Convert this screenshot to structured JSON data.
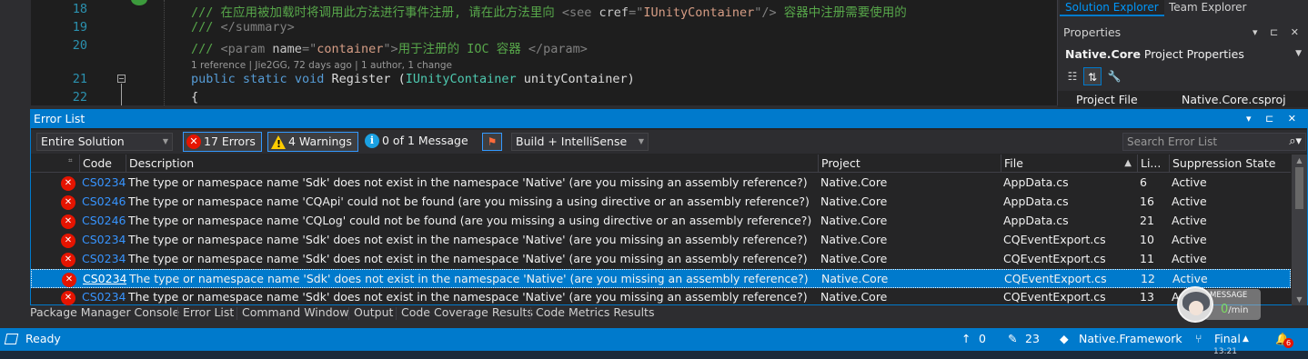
{
  "editor": {
    "lines": [
      {
        "num": "18",
        "segments": [
          {
            "cls": "c-com",
            "t": "/// 在应用被加载时将调用此方法进行事件注册, 请在此方法里向 "
          },
          {
            "cls": "c-tag",
            "t": "<see "
          },
          {
            "cls": "c-attr",
            "t": "cref"
          },
          {
            "cls": "c-tag",
            "t": "=\""
          },
          {
            "cls": "c-str",
            "t": "IUnityContainer"
          },
          {
            "cls": "c-tag",
            "t": "\"/>"
          },
          {
            "cls": "c-com",
            "t": " 容器中注册需要使用的"
          }
        ]
      },
      {
        "num": "19",
        "segments": [
          {
            "cls": "c-com",
            "t": "/// "
          },
          {
            "cls": "c-tag",
            "t": "</summary>"
          }
        ]
      },
      {
        "num": "20",
        "segments": [
          {
            "cls": "c-com",
            "t": "/// "
          },
          {
            "cls": "c-tag",
            "t": "<param "
          },
          {
            "cls": "c-attr",
            "t": "name"
          },
          {
            "cls": "c-tag",
            "t": "=\""
          },
          {
            "cls": "c-str",
            "t": "container"
          },
          {
            "cls": "c-tag",
            "t": "\">"
          },
          {
            "cls": "c-com",
            "t": "用于注册的 IOC 容器 "
          },
          {
            "cls": "c-tag",
            "t": "</param>"
          }
        ]
      },
      {
        "num": "21",
        "segments": [
          {
            "cls": "c-kw",
            "t": "public "
          },
          {
            "cls": "c-kw",
            "t": "static "
          },
          {
            "cls": "c-kw",
            "t": "void "
          },
          {
            "cls": "c-plain",
            "t": "Register ("
          },
          {
            "cls": "c-type",
            "t": "IUnityContainer"
          },
          {
            "cls": "c-plain",
            "t": " unityContainer)"
          }
        ]
      },
      {
        "num": "22",
        "segments": [
          {
            "cls": "c-plain",
            "t": "{"
          }
        ]
      }
    ],
    "codelens": "1 reference | Jie2GG, 72 days ago | 1 author, 1 change"
  },
  "right_panel": {
    "tabs": [
      "Solution Explorer",
      "Team Explorer"
    ],
    "properties_title": "Properties",
    "properties_buttons": "▾ ⊏ ✕",
    "object_name": "Native.Core",
    "object_type": "Project Properties",
    "toolbar_icons": [
      "categorized-icon",
      "alphabetical-icon",
      "wrench-icon"
    ],
    "row": {
      "name": "Project File",
      "value": "Native.Core.csproj"
    }
  },
  "error_list": {
    "title": "Error List",
    "title_buttons": "▾ ⊏ ✕",
    "scope": "Entire Solution",
    "errors_label": "17 Errors",
    "warnings_label": "4 Warnings",
    "messages_label": "0 of 1 Message",
    "build_filter": "Build + IntelliSense",
    "search_placeholder": "Search Error List",
    "columns": {
      "code": "Code",
      "description": "Description",
      "project": "Project",
      "file": "File",
      "line": "Li...",
      "suppression": "Suppression State"
    },
    "rows": [
      {
        "code": "CS0234",
        "description": "The type or namespace name 'Sdk' does not exist in the namespace 'Native' (are you missing an assembly reference?)",
        "project": "Native.Core",
        "file": "AppData.cs",
        "line": "6",
        "suppression": "Active"
      },
      {
        "code": "CS0246",
        "description": "The type or namespace name 'CQApi' could not be found (are you missing a using directive or an assembly reference?)",
        "project": "Native.Core",
        "file": "AppData.cs",
        "line": "16",
        "suppression": "Active"
      },
      {
        "code": "CS0246",
        "description": "The type or namespace name 'CQLog' could not be found (are you missing a using directive or an assembly reference?)",
        "project": "Native.Core",
        "file": "AppData.cs",
        "line": "21",
        "suppression": "Active"
      },
      {
        "code": "CS0234",
        "description": "The type or namespace name 'Sdk' does not exist in the namespace 'Native' (are you missing an assembly reference?)",
        "project": "Native.Core",
        "file": "CQEventExport.cs",
        "line": "10",
        "suppression": "Active"
      },
      {
        "code": "CS0234",
        "description": "The type or namespace name 'Sdk' does not exist in the namespace 'Native' (are you missing an assembly reference?)",
        "project": "Native.Core",
        "file": "CQEventExport.cs",
        "line": "11",
        "suppression": "Active"
      },
      {
        "code": "CS0234",
        "description": "The type or namespace name 'Sdk' does not exist in the namespace 'Native' (are you missing an assembly reference?)",
        "project": "Native.Core",
        "file": "CQEventExport.cs",
        "line": "12",
        "suppression": "Active",
        "selected": true
      },
      {
        "code": "CS0234",
        "description": "The type or namespace name 'Sdk' does not exist in the namespace 'Native' (are you missing an assembly reference?)",
        "project": "Native.Core",
        "file": "CQEventExport.cs",
        "line": "13",
        "suppression": "A"
      }
    ]
  },
  "bottom_tabs": [
    "Package Manager Console",
    "Error List",
    "Command Window",
    "Output",
    "Code Coverage Results",
    "Code Metrics Results"
  ],
  "status_bar": {
    "ready": "Ready",
    "up_count": "0",
    "edit_count": "23",
    "repo": "Native.Framework",
    "branch": "Final",
    "notifications": "6"
  },
  "message_widget": {
    "label": "MESSAGE",
    "rate": "0",
    "unit": "/min"
  },
  "taskbar": {
    "clock": "13:21"
  },
  "colors": {
    "accent": "#007acc",
    "error": "#e51400",
    "warning": "#ffcc00",
    "info": "#1ba1e2",
    "link": "#3794ff"
  }
}
